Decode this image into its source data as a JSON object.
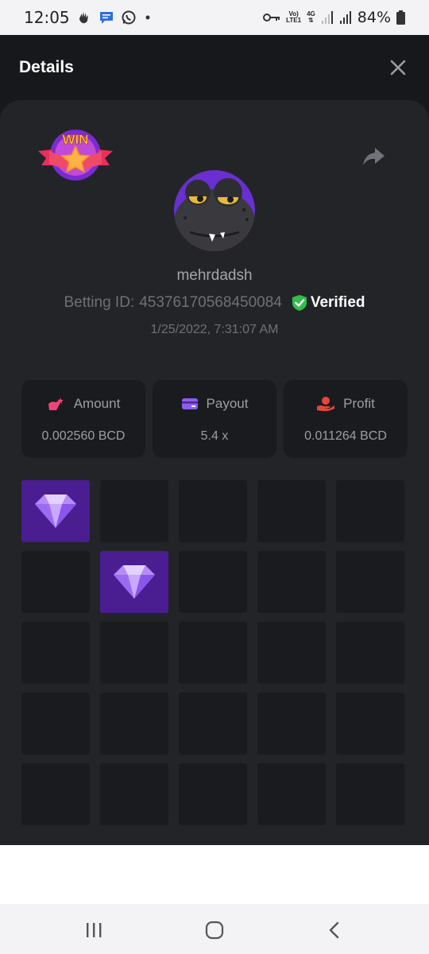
{
  "status_bar": {
    "time": "12:05",
    "battery": "84%",
    "network": "4G",
    "volte_top": "Vo)",
    "volte_bottom": "LTE1",
    "notification_icons": [
      "hand-wave-icon",
      "message-icon",
      "whatsapp-icon",
      "dot-icon"
    ],
    "system_icons": [
      "key-icon",
      "volte-icon",
      "network-4g-icon",
      "signal-icon",
      "signal-icon",
      "battery-icon"
    ]
  },
  "header": {
    "title": "Details",
    "close_icon": "close-icon"
  },
  "bet": {
    "badge_text": "WIN",
    "username": "mehrdadsh",
    "betting_label": "Betting ID:",
    "betting_id": "4537617056845008​4",
    "verified_label": "Verified",
    "timestamp": "1/25/2022, 7:31:07 AM"
  },
  "stats": [
    {
      "label": "Amount",
      "value": "0.002560 BCD",
      "icon": "amount-icon",
      "color": "#f0437c"
    },
    {
      "label": "Payout",
      "value": "5.4 x",
      "icon": "card-icon",
      "color": "#8b5cf6"
    },
    {
      "label": "Profit",
      "value": "0.011264 BCD",
      "icon": "profit-icon",
      "color": "#e5463c"
    }
  ],
  "grid": {
    "rows": 5,
    "cols": 5,
    "tiles": [
      "gem",
      "empty",
      "empty",
      "empty",
      "empty",
      "empty",
      "gem",
      "empty",
      "empty",
      "empty",
      "empty",
      "empty",
      "empty",
      "empty",
      "empty",
      "empty",
      "empty",
      "empty",
      "empty",
      "empty",
      "empty",
      "empty",
      "empty",
      "empty",
      "empty"
    ]
  },
  "colors": {
    "panel": "#232427",
    "tile": "#1a1b1e",
    "gem_tile": "#4a1d91",
    "verified": "#2fbf4a"
  },
  "nav_bar": {
    "buttons": [
      "recent-apps-icon",
      "home-icon",
      "back-icon"
    ]
  }
}
